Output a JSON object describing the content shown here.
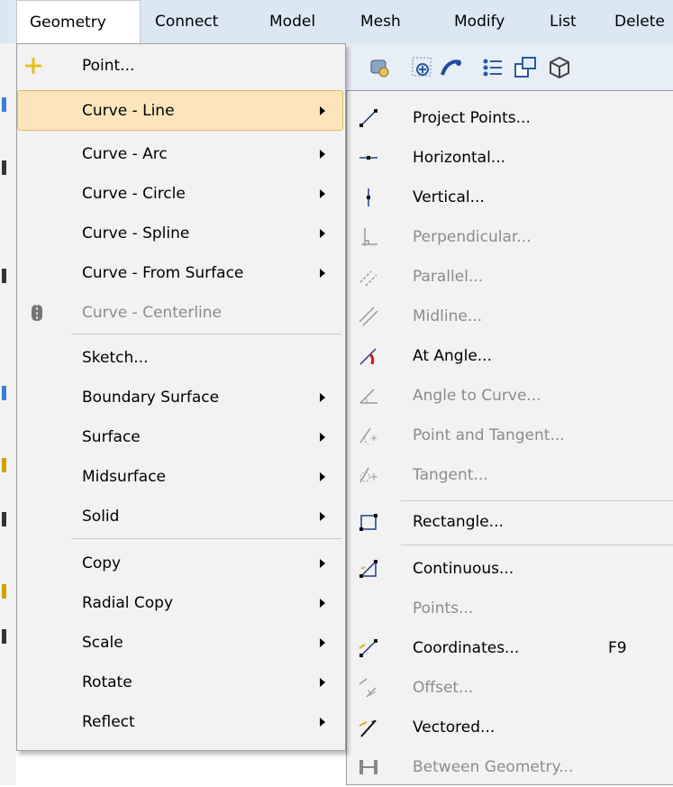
{
  "menubar": {
    "items": [
      "Geometry",
      "Connect",
      "Model",
      "Mesh",
      "Modify",
      "List",
      "Delete"
    ]
  },
  "geometry_menu": {
    "items": [
      {
        "label": "Point...",
        "submenu": false,
        "enabled": true
      },
      {
        "label": "Curve - Line",
        "submenu": true,
        "enabled": true,
        "highlighted": true
      },
      {
        "label": "Curve - Arc",
        "submenu": true,
        "enabled": true
      },
      {
        "label": "Curve - Circle",
        "submenu": true,
        "enabled": true
      },
      {
        "label": "Curve - Spline",
        "submenu": true,
        "enabled": true
      },
      {
        "label": "Curve - From Surface",
        "submenu": true,
        "enabled": true
      },
      {
        "label": "Curve - Centerline",
        "submenu": false,
        "enabled": false
      },
      {
        "label": "Sketch...",
        "submenu": false,
        "enabled": true
      },
      {
        "label": "Boundary Surface",
        "submenu": true,
        "enabled": true
      },
      {
        "label": "Surface",
        "submenu": true,
        "enabled": true
      },
      {
        "label": "Midsurface",
        "submenu": true,
        "enabled": true
      },
      {
        "label": "Solid",
        "submenu": true,
        "enabled": true
      },
      {
        "label": "Copy",
        "submenu": true,
        "enabled": true
      },
      {
        "label": "Radial Copy",
        "submenu": true,
        "enabled": true
      },
      {
        "label": "Scale",
        "submenu": true,
        "enabled": true
      },
      {
        "label": "Rotate",
        "submenu": true,
        "enabled": true
      },
      {
        "label": "Reflect",
        "submenu": true,
        "enabled": true
      }
    ]
  },
  "curve_line_submenu": {
    "items": [
      {
        "label": "Project Points...",
        "enabled": true,
        "icon": "project-points-icon"
      },
      {
        "label": "Horizontal...",
        "enabled": true,
        "icon": "horizontal-line-icon"
      },
      {
        "label": "Vertical...",
        "enabled": true,
        "icon": "vertical-line-icon"
      },
      {
        "label": "Perpendicular...",
        "enabled": false,
        "icon": "perpendicular-icon"
      },
      {
        "label": "Parallel...",
        "enabled": false,
        "icon": "parallel-icon"
      },
      {
        "label": "Midline...",
        "enabled": false,
        "icon": "midline-icon"
      },
      {
        "label": "At Angle...",
        "enabled": true,
        "icon": "at-angle-icon"
      },
      {
        "label": "Angle to Curve...",
        "enabled": false,
        "icon": "angle-to-curve-icon"
      },
      {
        "label": "Point and Tangent...",
        "enabled": false,
        "icon": "point-tangent-icon"
      },
      {
        "label": "Tangent...",
        "enabled": false,
        "icon": "tangent-icon"
      },
      {
        "label": "Rectangle...",
        "enabled": true,
        "icon": "rectangle-icon"
      },
      {
        "label": "Continuous...",
        "enabled": true,
        "icon": "continuous-icon"
      },
      {
        "label": "Points...",
        "enabled": false,
        "icon": ""
      },
      {
        "label": "Coordinates...",
        "enabled": true,
        "icon": "coordinates-icon",
        "shortcut": "F9"
      },
      {
        "label": "Offset...",
        "enabled": false,
        "icon": "offset-icon"
      },
      {
        "label": "Vectored...",
        "enabled": true,
        "icon": "vectored-icon"
      },
      {
        "label": "Between Geometry...",
        "enabled": false,
        "icon": "between-geometry-icon"
      }
    ]
  },
  "colors": {
    "menubar_bg": "#dce7f4",
    "menu_bg": "#f2f2f2",
    "highlight_bg": "#fce5bd",
    "highlight_border": "#e6b860",
    "disabled_text": "#8c8c8c"
  }
}
